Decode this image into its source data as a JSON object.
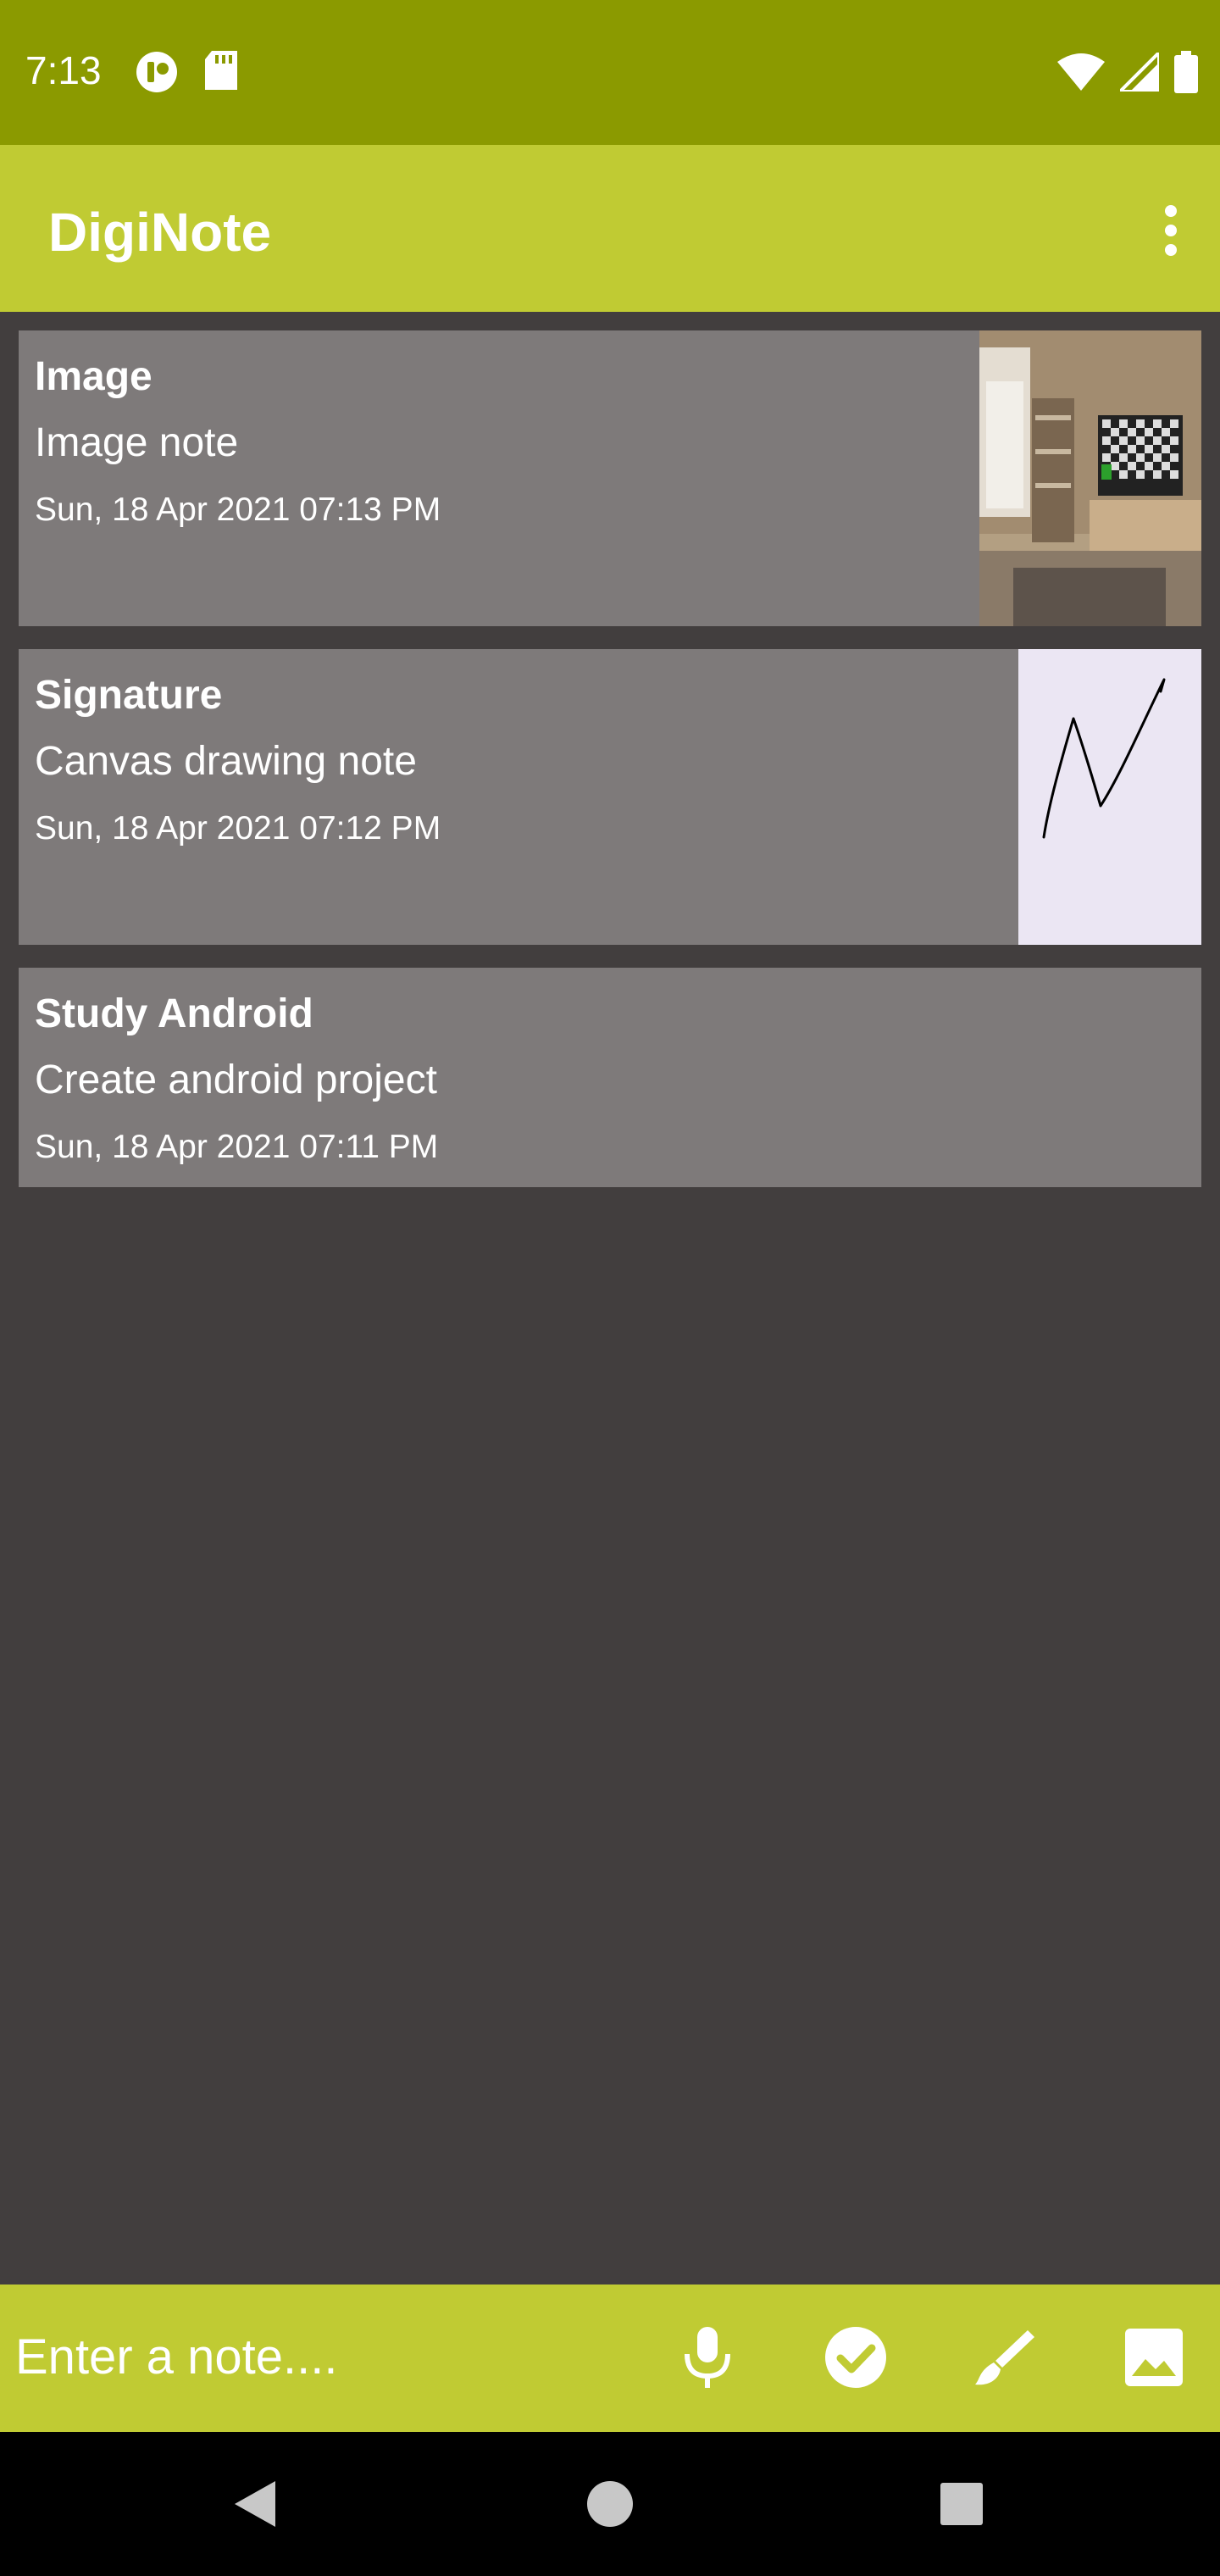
{
  "status_bar": {
    "time": "7:13",
    "icons": [
      "tip-icon",
      "sd-card-icon",
      "wifi-icon",
      "signal-icon",
      "battery-icon"
    ]
  },
  "app_bar": {
    "title": "DigiNote",
    "menu_icon": "more-vert-icon"
  },
  "notes": [
    {
      "title": "Image",
      "body": "Image note",
      "date": "Sun, 18 Apr 2021  07:13 PM",
      "thumbnail": "room-photo"
    },
    {
      "title": "Signature",
      "body": "Canvas drawing note",
      "date": "Sun, 18 Apr 2021  07:12 PM",
      "thumbnail": "signature-drawing"
    },
    {
      "title": "Study Android",
      "body": "Create android project",
      "date": "Sun, 18 Apr 2021  07:11 PM",
      "thumbnail": ""
    }
  ],
  "input_bar": {
    "placeholder": "Enter a note....",
    "actions": [
      "mic-icon",
      "check-circle-icon",
      "brush-icon",
      "image-icon"
    ]
  },
  "nav_bar": {
    "buttons": [
      "back-icon",
      "home-icon",
      "recents-icon"
    ]
  },
  "colors": {
    "status_bar": "#8b9a00",
    "app_bar": "#c0cb33",
    "background": "#423e3e",
    "card": "#7e7a7a",
    "signature_bg": "#ebe6f3"
  }
}
